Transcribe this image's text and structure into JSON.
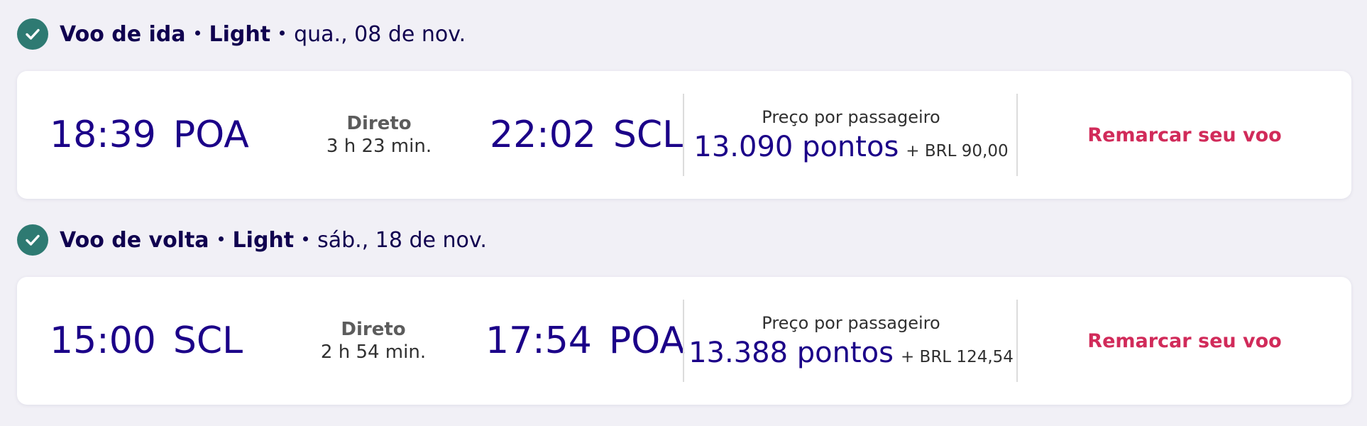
{
  "flights": [
    {
      "header": {
        "direction": "Voo de ida",
        "fare": "Light",
        "date": "qua., 08 de nov."
      },
      "departure": {
        "time": "18:39",
        "airport": "POA"
      },
      "duration": {
        "type": "Direto",
        "length": "3 h 23 min."
      },
      "arrival": {
        "time": "22:02",
        "airport": "SCL"
      },
      "price": {
        "label": "Preço por passageiro",
        "points": "13.090 pontos",
        "extra": "+ BRL 90,00"
      },
      "action_label": "Remarcar seu voo"
    },
    {
      "header": {
        "direction": "Voo de volta",
        "fare": "Light",
        "date": "sáb., 18 de nov."
      },
      "departure": {
        "time": "15:00",
        "airport": "SCL"
      },
      "duration": {
        "type": "Direto",
        "length": "2 h 54 min."
      },
      "arrival": {
        "time": "17:54",
        "airport": "POA"
      },
      "price": {
        "label": "Preço por passageiro",
        "points": "13.388 pontos",
        "extra": "+ BRL 124,54"
      },
      "action_label": "Remarcar seu voo"
    }
  ],
  "icons": {
    "status": "check-circle-icon"
  },
  "colors": {
    "background": "#f1f0f6",
    "primary_text": "#10004f",
    "time_text": "#1b0088",
    "success": "#2e7a72",
    "action": "#d12b5a"
  }
}
